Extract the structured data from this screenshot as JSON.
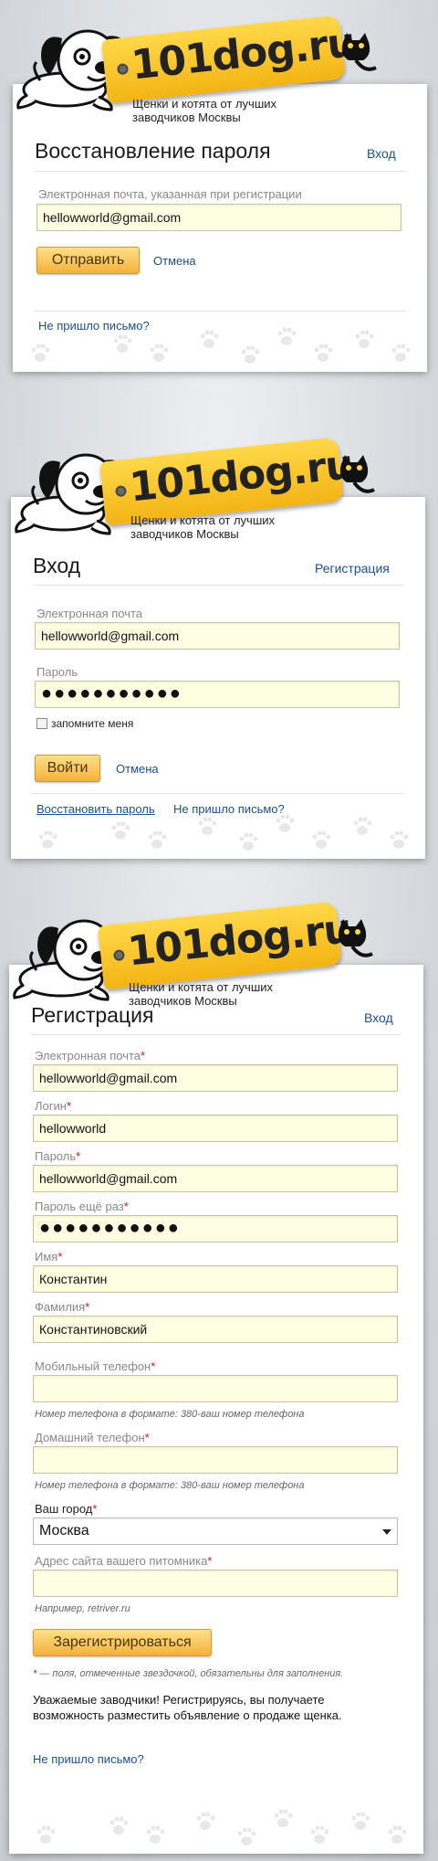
{
  "brand": {
    "logo_text": "101dog.ru",
    "slogan": "Щенки и котята от лучших заводчиков Москвы"
  },
  "recover": {
    "title": "Восстановление пароля",
    "login_link": "Вход",
    "email_label": "Электронная почта, указанная при регистрации",
    "email_value": "hellowworld@gmail.com",
    "submit_label": "Отправить",
    "cancel_label": "Отмена",
    "no_letter_link": "Не пришло письмо?"
  },
  "login": {
    "title": "Вход",
    "register_link": "Регистрация",
    "email_label": "Электронная почта",
    "email_value": "hellowworld@gmail.com",
    "password_label": "Пароль",
    "password_value": "●●●●●●●●●●●",
    "remember_label": "запомните меня",
    "submit_label": "Войти",
    "cancel_label": "Отмена",
    "restore_link": "Восстановить пароль",
    "no_letter_link": "Не пришло письмо?"
  },
  "register": {
    "title": "Регистрация",
    "login_link": "Вход",
    "required_mark": "*",
    "email_label": "Электронная почта",
    "email_value": "hellowworld@gmail.com",
    "login_label": "Логин",
    "login_value": "hellowworld",
    "password_label": "Пароль",
    "password_value": "hellowworld@gmail.com",
    "password2_label": "Пароль ещё раз",
    "password2_value": "●●●●●●●●●●●",
    "name_label": "Имя",
    "name_value": "Константин",
    "surname_label": "Фамилия",
    "surname_value": "Константиновский",
    "mobile_label": "Мобильный телефон",
    "mobile_value": "",
    "mobile_hint": "Номер телефона в формате: 380-ваш номер телефона",
    "home_label": "Домашний телефон",
    "home_value": "",
    "home_hint": "Номер телефона в формате: 380-ваш номер телефона",
    "city_label": "Ваш город",
    "city_value": "Москва",
    "site_label": "Адрес сайта вашего питомника",
    "site_value": "",
    "site_hint": "Например, retriver.ru",
    "submit_label": "Зарегистрироваться",
    "required_note": "— поля, отмеченные звездочкой, обязательны для заполнения.",
    "info_text": "Уважаемые заводчики! Регистрируясь, вы получаете возможность разместить объявление о продаже щенка.",
    "no_letter_link": "Не пришло письмо?"
  }
}
